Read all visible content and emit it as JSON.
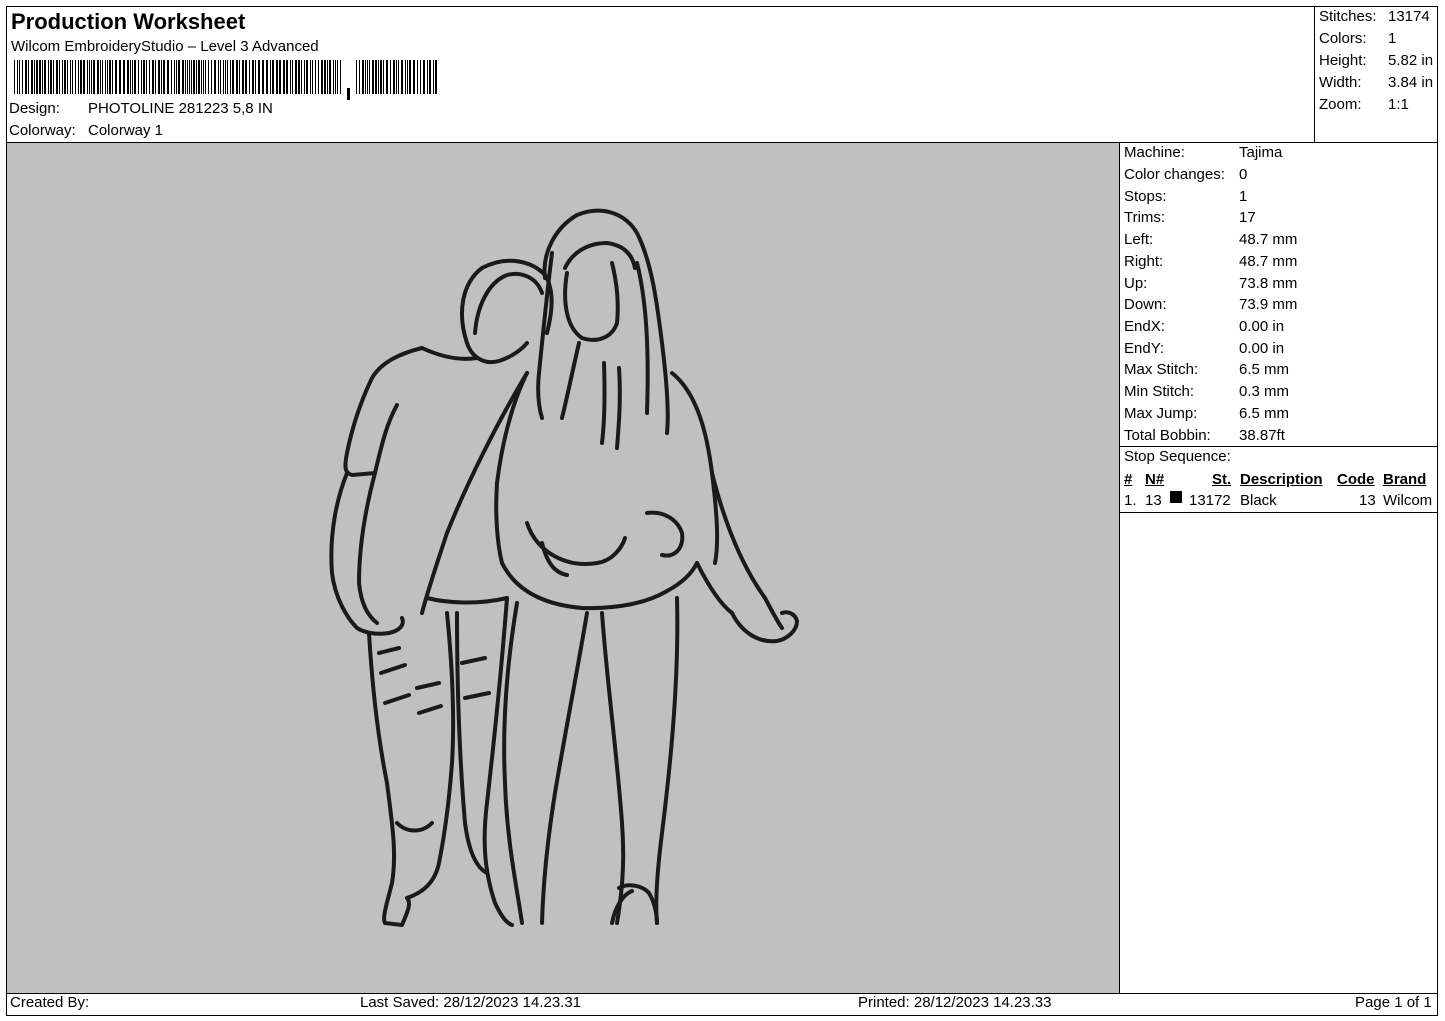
{
  "header": {
    "title": "Production Worksheet",
    "software": "Wilcom EmbroideryStudio – Level 3 Advanced",
    "design_label": "Design:",
    "design_value": "PHOTOLINE 281223 5,8 IN",
    "colorway_label": "Colorway:",
    "colorway_value": "Colorway 1"
  },
  "summary": [
    {
      "label": "Stitches:",
      "value": "13174"
    },
    {
      "label": "Colors:",
      "value": "1"
    },
    {
      "label": "Height:",
      "value": "5.82 in"
    },
    {
      "label": "Width:",
      "value": "3.84 in"
    },
    {
      "label": "Zoom:",
      "value": "1:1"
    }
  ],
  "details": [
    {
      "label": "Machine:",
      "value": "Tajima"
    },
    {
      "label": "Color changes:",
      "value": "0"
    },
    {
      "label": "Stops:",
      "value": "1"
    },
    {
      "label": "Trims:",
      "value": "17"
    },
    {
      "label": "Left:",
      "value": "48.7 mm"
    },
    {
      "label": "Right:",
      "value": "48.7 mm"
    },
    {
      "label": "Up:",
      "value": "73.8 mm"
    },
    {
      "label": "Down:",
      "value": "73.9 mm"
    },
    {
      "label": "EndX:",
      "value": "0.00 in"
    },
    {
      "label": "EndY:",
      "value": "0.00 in"
    },
    {
      "label": "Max Stitch:",
      "value": "6.5 mm"
    },
    {
      "label": "Min Stitch:",
      "value": "0.3 mm"
    },
    {
      "label": "Max Jump:",
      "value": "6.5 mm"
    },
    {
      "label": "Total Bobbin:",
      "value": "38.87ft"
    }
  ],
  "stop_sequence": {
    "label": "Stop Sequence:",
    "headers": {
      "num": "#",
      "needle": "N#",
      "stitches": "St.",
      "description": "Description",
      "code": "Code",
      "brand": "Brand"
    },
    "rows": [
      {
        "num": "1.",
        "needle": "13",
        "color": "#000000",
        "stitches": "13172",
        "description": "Black",
        "code": "13",
        "brand": "Wilcom"
      }
    ]
  },
  "footer": {
    "created_by": "Created By:",
    "last_saved": "Last Saved: 28/12/2023 14.23.31",
    "printed": "Printed: 28/12/2023 14.23.33",
    "page": "Page 1 of 1"
  },
  "colors": {
    "canvas_bg": "#c0c0c0",
    "thread": "#1a1a1a"
  }
}
